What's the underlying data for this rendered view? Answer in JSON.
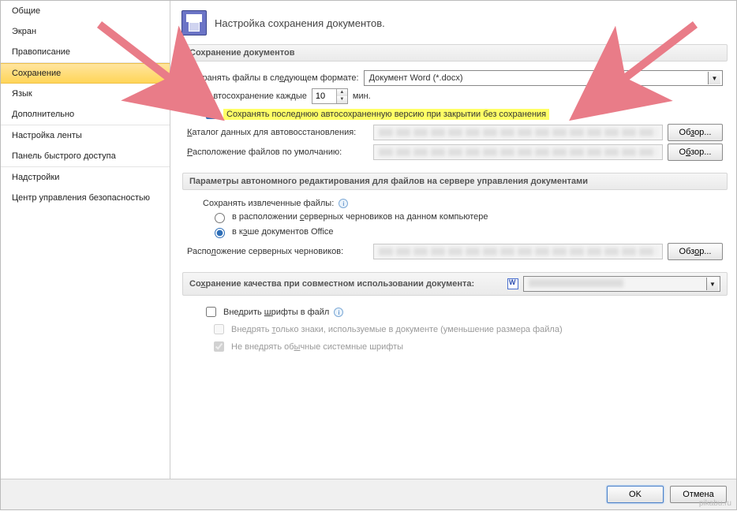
{
  "sidebar": {
    "items": [
      {
        "label": "Общие"
      },
      {
        "label": "Экран"
      },
      {
        "label": "Правописание"
      },
      {
        "label": "Сохранение",
        "selected": true
      },
      {
        "label": "Язык"
      },
      {
        "label": "Дополнительно"
      },
      {
        "label": "Настройка ленты"
      },
      {
        "label": "Панель быстрого доступа"
      },
      {
        "label": "Надстройки"
      },
      {
        "label": "Центр управления безопасностью"
      }
    ],
    "separators_after": [
      2,
      5,
      7
    ]
  },
  "header": {
    "title": "Настройка сохранения документов."
  },
  "save_section": {
    "title": "Сохранение документов",
    "format_label": "Сохранять файлы в следующем формате:",
    "format_value": "Документ Word (*.docx)",
    "autosave_label": "Автосохранение каждые",
    "autosave_value": "10",
    "autosave_unit": "мин.",
    "autosave_checked": true,
    "keep_last_label": "Сохранять последнюю автосохраненную версию при закрытии без сохранения",
    "keep_last_checked": true,
    "recovery_label": "Каталог данных для автовосстановления:",
    "default_loc_label": "Расположение файлов по умолчанию:",
    "browse": "Обзор..."
  },
  "offline_section": {
    "title": "Параметры автономного редактирования для файлов на сервере управления документами",
    "save_extracted_label": "Сохранять извлеченные файлы:",
    "opt_server": "в расположении серверных черновиков на данном компьютере",
    "opt_cache": "в кэше документов Office",
    "drafts_loc_label": "Расположение серверных черновиков:",
    "browse": "Обзор..."
  },
  "quality_section": {
    "title": "Сохранение качества при совместном использовании документа:",
    "embed_fonts_label": "Внедрить шрифты в файл",
    "embed_only_used": "Внедрять только знаки, используемые в документе (уменьшение размера файла)",
    "no_system_fonts": "Не внедрять обычные системные шрифты"
  },
  "buttons": {
    "ok": "OK",
    "cancel": "Отмена"
  },
  "watermark": "pikabu.ru"
}
